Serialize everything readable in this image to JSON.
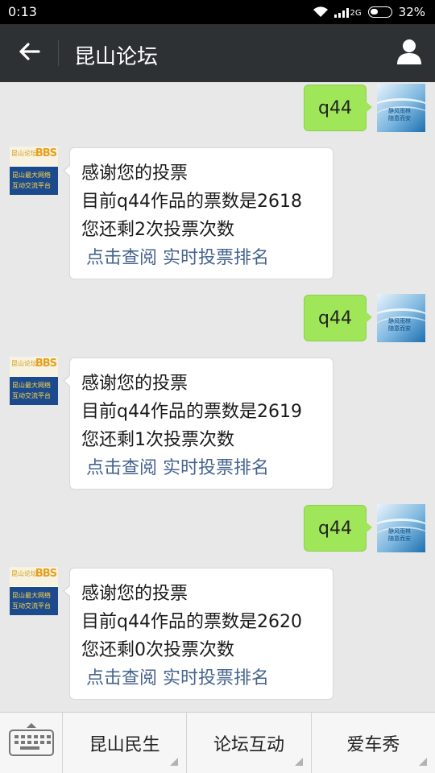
{
  "status_bar": {
    "time": "0:13",
    "battery": "32%",
    "signal_label": "2G"
  },
  "header": {
    "title": "昆山论坛"
  },
  "avatars": {
    "bot": {
      "logo_cn": "昆山论坛",
      "logo_en": "BBS",
      "slogan_line1": "昆山最大网络",
      "slogan_line2": "互动交流平台"
    },
    "user": {
      "line1": "静风雨林",
      "line2": "随意而安"
    }
  },
  "messages": [
    {
      "type": "sent",
      "text": "q44"
    },
    {
      "type": "received",
      "line1": "感谢您的投票",
      "line2": "目前q44作品的票数是2618",
      "line3": "您还剩2次投票次数",
      "link1": "点击查阅",
      "link2": "实时投票排名"
    },
    {
      "type": "sent",
      "text": "q44"
    },
    {
      "type": "received",
      "line1": "感谢您的投票",
      "line2": "目前q44作品的票数是2619",
      "line3": "您还剩1次投票次数",
      "link1": "点击查阅",
      "link2": "实时投票排名"
    },
    {
      "type": "sent",
      "text": "q44"
    },
    {
      "type": "received",
      "line1": "感谢您的投票",
      "line2": "目前q44作品的票数是2620",
      "line3": "您还剩0次投票次数",
      "link1": "点击查阅",
      "link2": "实时投票排名"
    }
  ],
  "bottom_menu": [
    {
      "label": "昆山民生"
    },
    {
      "label": "论坛互动"
    },
    {
      "label": "爱车秀"
    }
  ],
  "icons": {
    "back": "arrow-left-icon",
    "profile": "person-icon",
    "keyboard": "keyboard-icon"
  },
  "colors": {
    "header_bg": "#2d3133",
    "sent_bubble": "#9fe658",
    "link": "#45648e",
    "chat_bg": "#e8e8e8"
  }
}
